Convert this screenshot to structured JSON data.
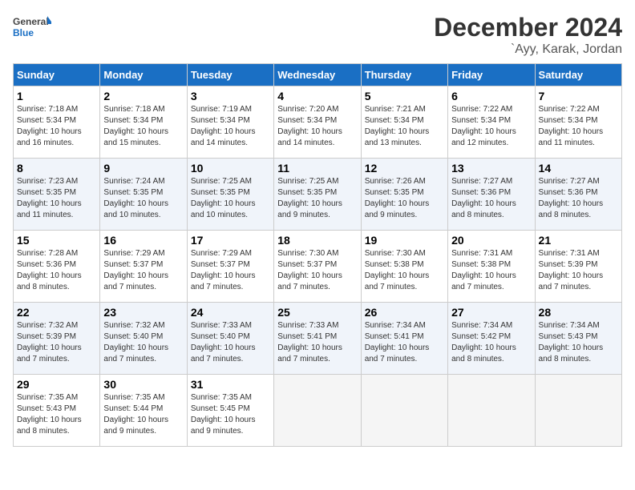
{
  "logo": {
    "line1": "General",
    "line2": "Blue"
  },
  "title": "December 2024",
  "subtitle": "`Ayy, Karak, Jordan",
  "days_of_week": [
    "Sunday",
    "Monday",
    "Tuesday",
    "Wednesday",
    "Thursday",
    "Friday",
    "Saturday"
  ],
  "weeks": [
    [
      {
        "day": 1,
        "sunrise": "7:18 AM",
        "sunset": "5:34 PM",
        "daylight": "10 hours and 16 minutes."
      },
      {
        "day": 2,
        "sunrise": "7:18 AM",
        "sunset": "5:34 PM",
        "daylight": "10 hours and 15 minutes."
      },
      {
        "day": 3,
        "sunrise": "7:19 AM",
        "sunset": "5:34 PM",
        "daylight": "10 hours and 14 minutes."
      },
      {
        "day": 4,
        "sunrise": "7:20 AM",
        "sunset": "5:34 PM",
        "daylight": "10 hours and 14 minutes."
      },
      {
        "day": 5,
        "sunrise": "7:21 AM",
        "sunset": "5:34 PM",
        "daylight": "10 hours and 13 minutes."
      },
      {
        "day": 6,
        "sunrise": "7:22 AM",
        "sunset": "5:34 PM",
        "daylight": "10 hours and 12 minutes."
      },
      {
        "day": 7,
        "sunrise": "7:22 AM",
        "sunset": "5:34 PM",
        "daylight": "10 hours and 11 minutes."
      }
    ],
    [
      {
        "day": 8,
        "sunrise": "7:23 AM",
        "sunset": "5:35 PM",
        "daylight": "10 hours and 11 minutes."
      },
      {
        "day": 9,
        "sunrise": "7:24 AM",
        "sunset": "5:35 PM",
        "daylight": "10 hours and 10 minutes."
      },
      {
        "day": 10,
        "sunrise": "7:25 AM",
        "sunset": "5:35 PM",
        "daylight": "10 hours and 10 minutes."
      },
      {
        "day": 11,
        "sunrise": "7:25 AM",
        "sunset": "5:35 PM",
        "daylight": "10 hours and 9 minutes."
      },
      {
        "day": 12,
        "sunrise": "7:26 AM",
        "sunset": "5:35 PM",
        "daylight": "10 hours and 9 minutes."
      },
      {
        "day": 13,
        "sunrise": "7:27 AM",
        "sunset": "5:36 PM",
        "daylight": "10 hours and 8 minutes."
      },
      {
        "day": 14,
        "sunrise": "7:27 AM",
        "sunset": "5:36 PM",
        "daylight": "10 hours and 8 minutes."
      }
    ],
    [
      {
        "day": 15,
        "sunrise": "7:28 AM",
        "sunset": "5:36 PM",
        "daylight": "10 hours and 8 minutes."
      },
      {
        "day": 16,
        "sunrise": "7:29 AM",
        "sunset": "5:37 PM",
        "daylight": "10 hours and 7 minutes."
      },
      {
        "day": 17,
        "sunrise": "7:29 AM",
        "sunset": "5:37 PM",
        "daylight": "10 hours and 7 minutes."
      },
      {
        "day": 18,
        "sunrise": "7:30 AM",
        "sunset": "5:37 PM",
        "daylight": "10 hours and 7 minutes."
      },
      {
        "day": 19,
        "sunrise": "7:30 AM",
        "sunset": "5:38 PM",
        "daylight": "10 hours and 7 minutes."
      },
      {
        "day": 20,
        "sunrise": "7:31 AM",
        "sunset": "5:38 PM",
        "daylight": "10 hours and 7 minutes."
      },
      {
        "day": 21,
        "sunrise": "7:31 AM",
        "sunset": "5:39 PM",
        "daylight": "10 hours and 7 minutes."
      }
    ],
    [
      {
        "day": 22,
        "sunrise": "7:32 AM",
        "sunset": "5:39 PM",
        "daylight": "10 hours and 7 minutes."
      },
      {
        "day": 23,
        "sunrise": "7:32 AM",
        "sunset": "5:40 PM",
        "daylight": "10 hours and 7 minutes."
      },
      {
        "day": 24,
        "sunrise": "7:33 AM",
        "sunset": "5:40 PM",
        "daylight": "10 hours and 7 minutes."
      },
      {
        "day": 25,
        "sunrise": "7:33 AM",
        "sunset": "5:41 PM",
        "daylight": "10 hours and 7 minutes."
      },
      {
        "day": 26,
        "sunrise": "7:34 AM",
        "sunset": "5:41 PM",
        "daylight": "10 hours and 7 minutes."
      },
      {
        "day": 27,
        "sunrise": "7:34 AM",
        "sunset": "5:42 PM",
        "daylight": "10 hours and 8 minutes."
      },
      {
        "day": 28,
        "sunrise": "7:34 AM",
        "sunset": "5:43 PM",
        "daylight": "10 hours and 8 minutes."
      }
    ],
    [
      {
        "day": 29,
        "sunrise": "7:35 AM",
        "sunset": "5:43 PM",
        "daylight": "10 hours and 8 minutes."
      },
      {
        "day": 30,
        "sunrise": "7:35 AM",
        "sunset": "5:44 PM",
        "daylight": "10 hours and 9 minutes."
      },
      {
        "day": 31,
        "sunrise": "7:35 AM",
        "sunset": "5:45 PM",
        "daylight": "10 hours and 9 minutes."
      },
      null,
      null,
      null,
      null
    ]
  ]
}
